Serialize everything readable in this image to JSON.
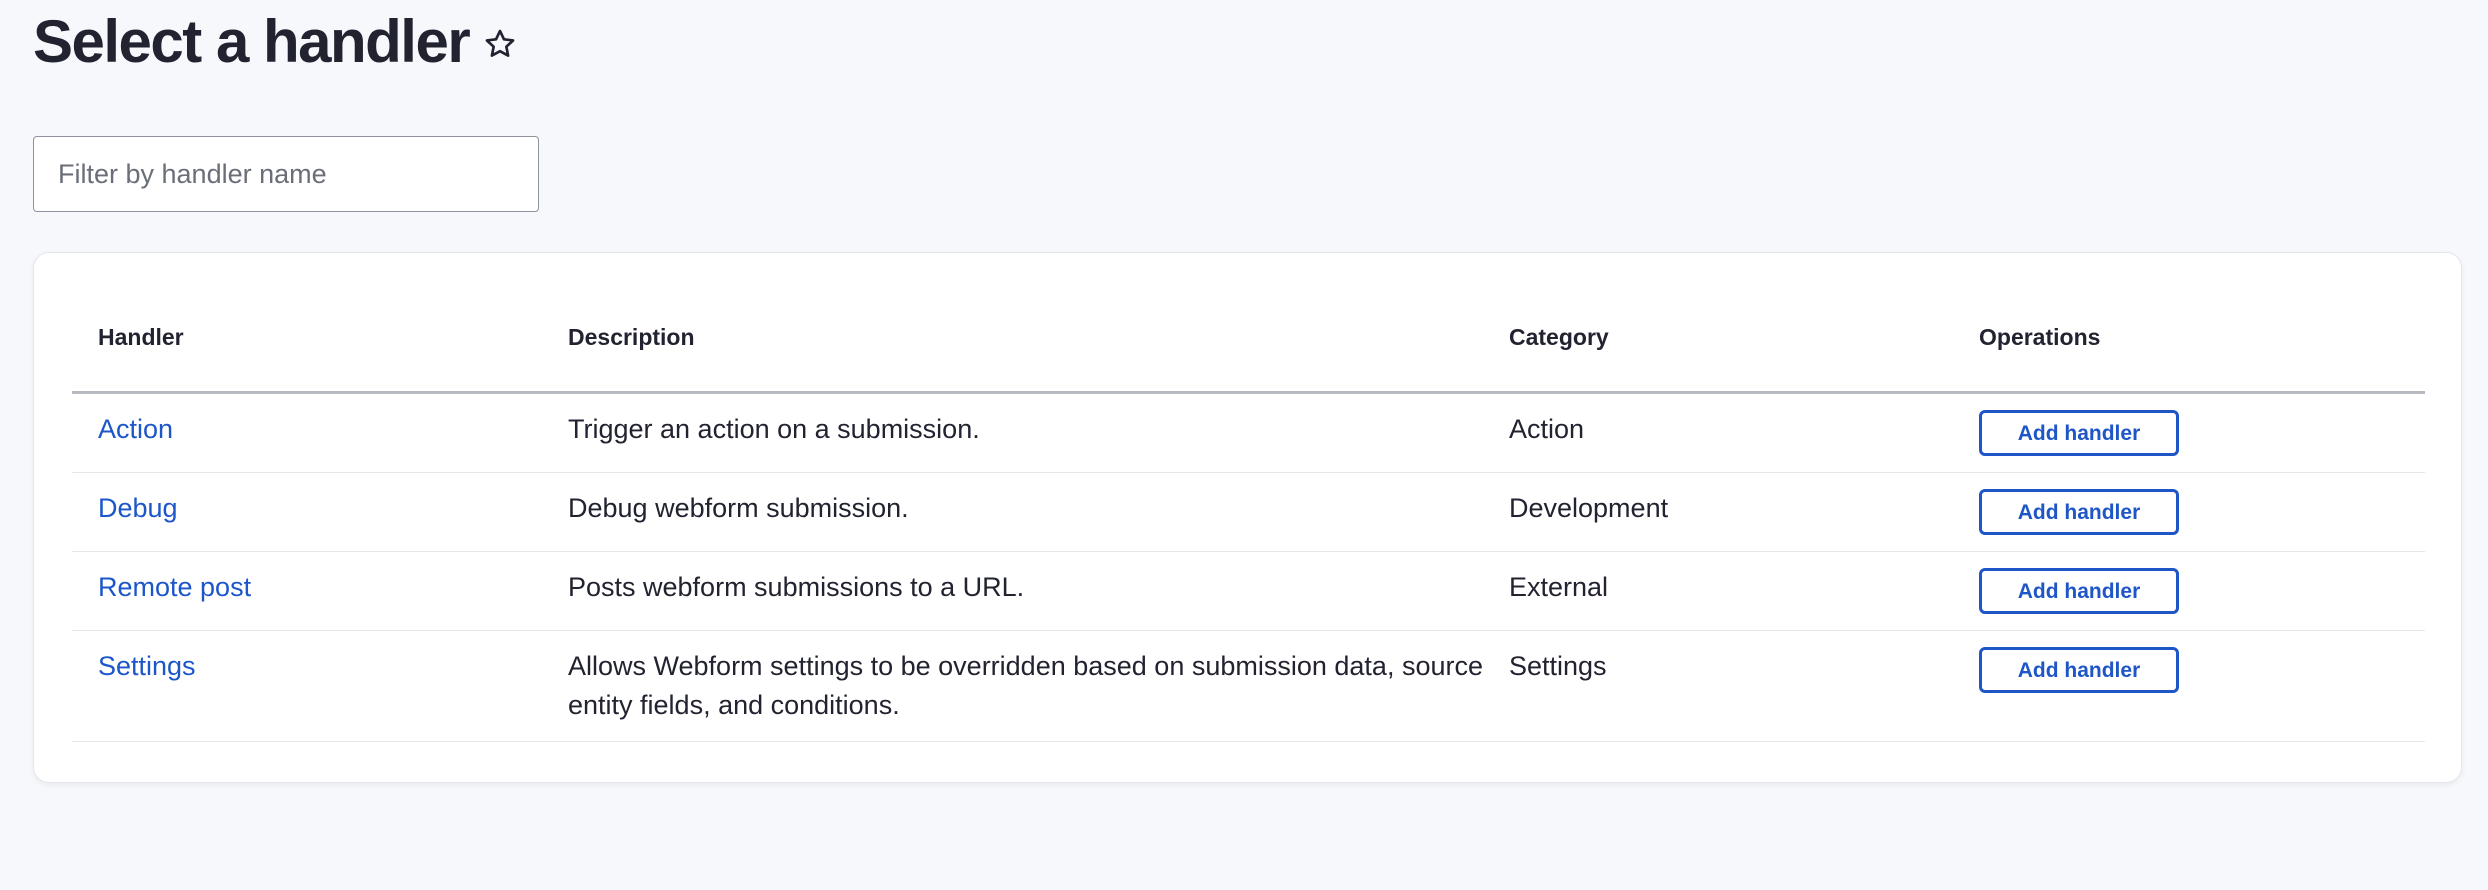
{
  "page": {
    "title": "Select a handler",
    "star_icon": "star-outline-icon"
  },
  "filter": {
    "placeholder": "Filter by handler name",
    "value": ""
  },
  "table": {
    "headers": {
      "handler": "Handler",
      "description": "Description",
      "category": "Category",
      "operations": "Operations"
    },
    "rows": [
      {
        "handler": "Action",
        "description": "Trigger an action on a submission.",
        "category": "Action",
        "operation": "Add handler"
      },
      {
        "handler": "Debug",
        "description": "Debug webform submission.",
        "category": "Development",
        "operation": "Add handler"
      },
      {
        "handler": "Remote post",
        "description": "Posts webform submissions to a URL.",
        "category": "External",
        "operation": "Add handler"
      },
      {
        "handler": "Settings",
        "description": "Allows Webform settings to be overridden based on submission data, source entity fields, and conditions.",
        "category": "Settings",
        "operation": "Add handler"
      }
    ]
  },
  "colors": {
    "link": "#1c56c9",
    "button_border": "#1f56c7",
    "background": "#f7f8fc"
  }
}
